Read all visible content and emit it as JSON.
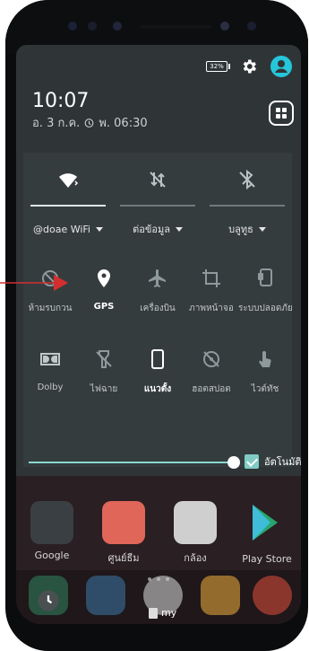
{
  "status": {
    "battery_label": "32%",
    "time": "10:07",
    "date": "อ. 3 ก.ค.",
    "alarm_time": "พ. 06:30"
  },
  "toggles": [
    {
      "label": "@doae WiFi",
      "icon": "wifi-icon",
      "on": true
    },
    {
      "label": "ต่อข้อมูล",
      "icon": "mobile-data-off-icon",
      "on": false
    },
    {
      "label": "บลูทูธ",
      "icon": "bluetooth-off-icon",
      "on": false
    }
  ],
  "tiles": [
    {
      "label": "ห้ามรบกวน",
      "icon": "dnd-icon",
      "active": false
    },
    {
      "label": "GPS",
      "icon": "location-icon",
      "active": true
    },
    {
      "label": "เครื่องบิน",
      "icon": "airplane-icon",
      "active": false
    },
    {
      "label": "ภาพหน้าจอ",
      "icon": "crop-icon",
      "active": false
    },
    {
      "label": "ระบบปลอดภัย",
      "icon": "secure-icon",
      "active": false
    },
    {
      "label": "Dolby",
      "icon": "dolby-icon",
      "active": false
    },
    {
      "label": "ไฟฉาย",
      "icon": "flashlight-off-icon",
      "active": false
    },
    {
      "label": "แนวตั้ง",
      "icon": "portrait-icon",
      "active": true
    },
    {
      "label": "ฮอตสปอต",
      "icon": "hotspot-off-icon",
      "active": false
    },
    {
      "label": "ไวต์ทัช",
      "icon": "touch-icon",
      "active": false
    }
  ],
  "brightness": {
    "auto_label": "อัตโนมัติ",
    "level": 0.95
  },
  "apps": [
    {
      "label": "Google",
      "icon": "google-folder-icon"
    },
    {
      "label": "ศูนย์ธีม",
      "icon": "theme-center-icon"
    },
    {
      "label": "กล้อง",
      "icon": "camera-icon"
    },
    {
      "label": "Play Store",
      "icon": "play-store-icon"
    }
  ],
  "dock": {
    "label": "my"
  },
  "colors": {
    "panel": "#353c3e",
    "screen": "#2f3537",
    "accent": "#80cbc4",
    "arrow": "#d32f2f"
  }
}
